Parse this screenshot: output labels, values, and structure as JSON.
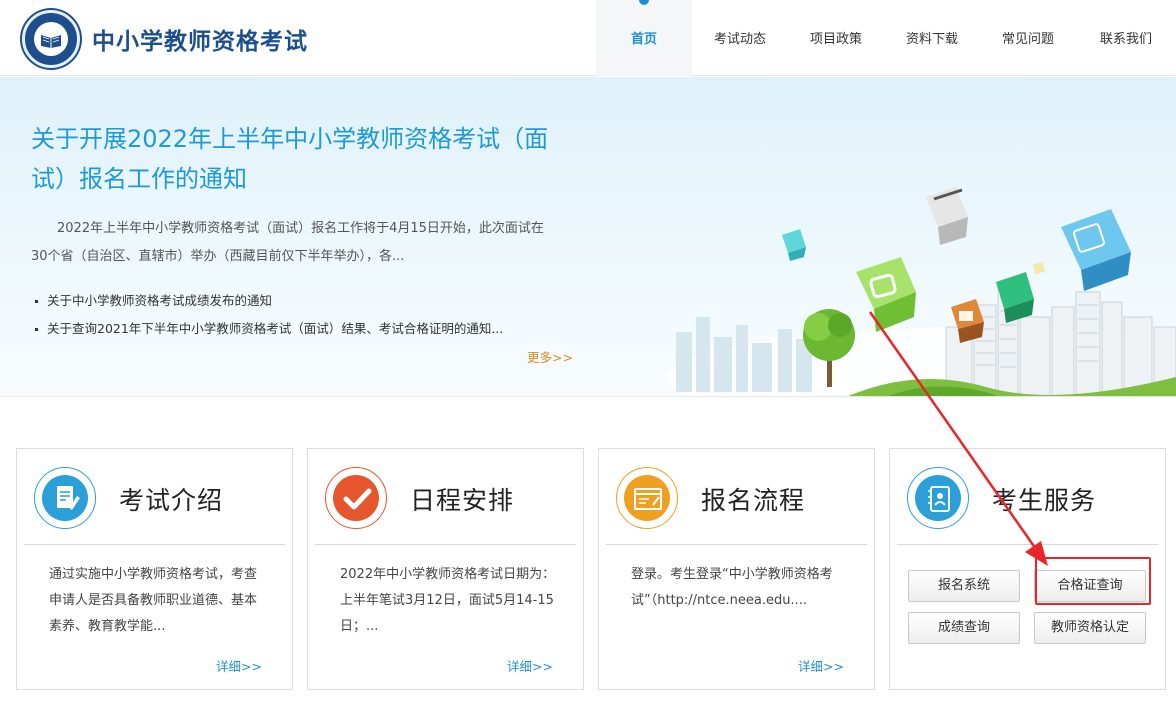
{
  "header": {
    "site_title": "中小学教师资格考试",
    "nav": [
      {
        "label": "首页",
        "active": true
      },
      {
        "label": "考试动态",
        "active": false
      },
      {
        "label": "项目政策",
        "active": false
      },
      {
        "label": "资料下载",
        "active": false
      },
      {
        "label": "常见问题",
        "active": false
      },
      {
        "label": "联系我们",
        "active": false
      }
    ]
  },
  "banner": {
    "title": "关于开展2022年上半年中小学教师资格考试（面试）报名工作的通知",
    "summary": "2022年上半年中小学教师资格考试（面试）报名工作将于4月15日开始，此次面试在30个省（自治区、直辖市）举办（西藏目前仅下半年举办），各...",
    "links": [
      "关于中小学教师资格考试成绩发布的通知",
      "关于查询2021年下半年中小学教师资格考试（面试）结果、考试合格证明的通知..."
    ],
    "more": "更多>>"
  },
  "cards": [
    {
      "title": "考试介绍",
      "body": "通过实施中小学教师资格考试，考查申请人是否具备教师职业道德、基本素养、教育教学能...",
      "detail": "详细>>",
      "icon": "document-pen-icon",
      "color": "#2a9fd8"
    },
    {
      "title": "日程安排",
      "body": "2022年中小学教师资格考试日期为：上半年笔试3月12日，面试5月14-15日；...",
      "detail": "详细>>",
      "icon": "checkmark-icon",
      "color": "#e5562d"
    },
    {
      "title": "报名流程",
      "body": "登录。考生登录“中小学教师资格考试”（http://ntce.neea.edu....",
      "detail": "详细>>",
      "icon": "form-window-icon",
      "color": "#f0a020"
    },
    {
      "title": "考生服务",
      "icon": "contact-book-icon",
      "color": "#2a9fd8"
    }
  ],
  "services": [
    "报名系统",
    "合格证查询",
    "成绩查询",
    "教师资格认定"
  ]
}
